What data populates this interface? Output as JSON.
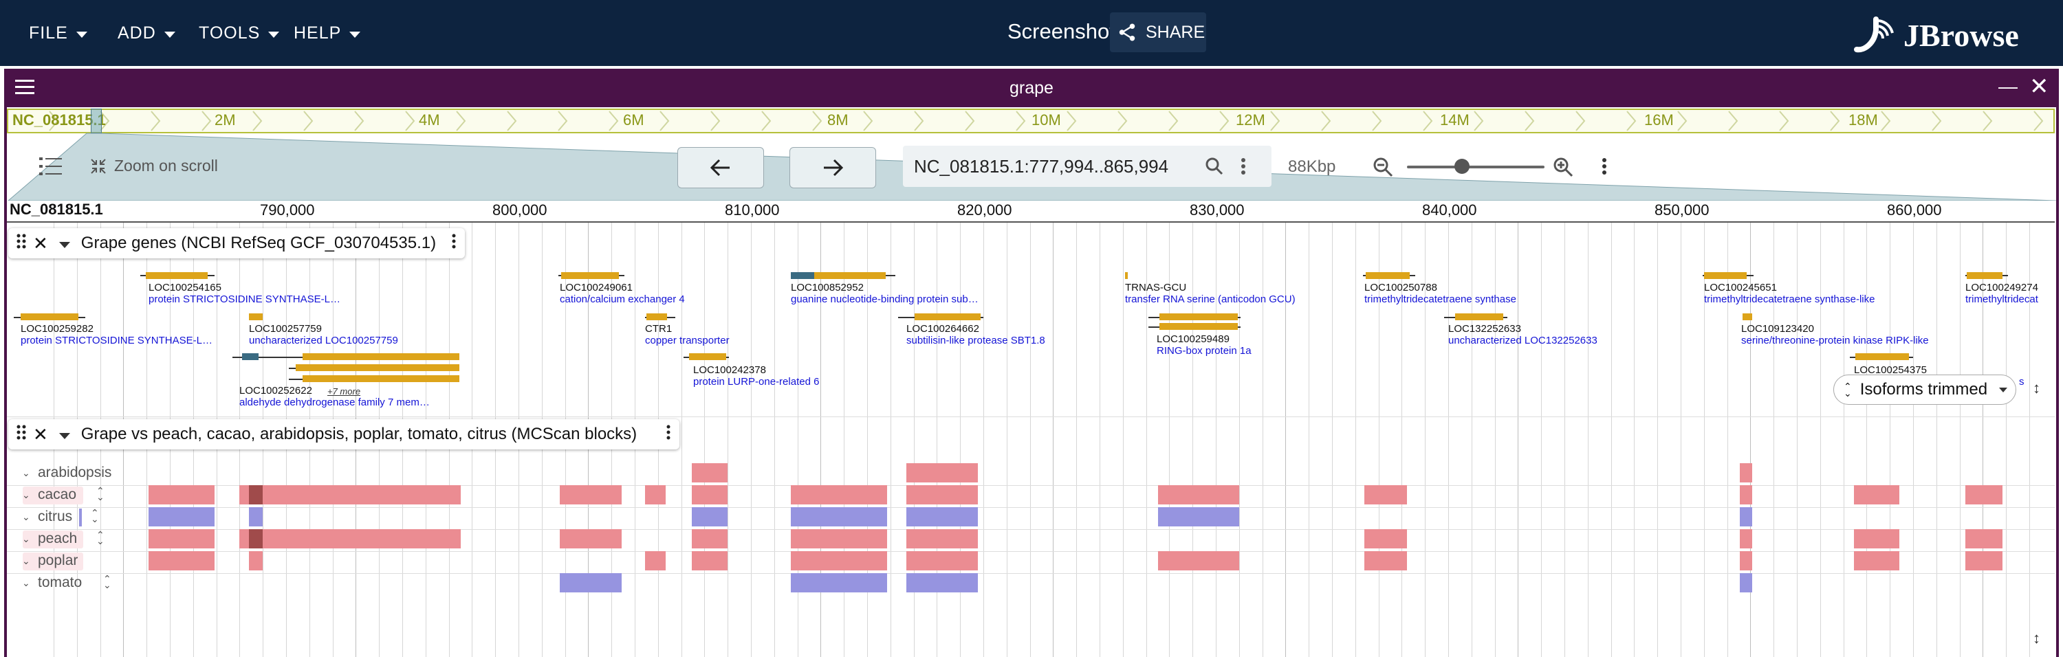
{
  "menus": [
    {
      "label": "FILE"
    },
    {
      "label": "ADD"
    },
    {
      "label": "TOOLS"
    },
    {
      "label": "HELP"
    }
  ],
  "session_title": "Screenshot",
  "share_label": "SHARE",
  "brand": "JBrowse",
  "view": {
    "title": "grape",
    "refname": "NC_081815.1",
    "overview_labels": [
      "NC_081815.1",
      "2M",
      "4M",
      "6M",
      "8M",
      "10M",
      "12M",
      "14M",
      "16M",
      "18M"
    ],
    "zoom_on_scroll_label": "Zoom on scroll",
    "locstring": "NC_081815.1:777,994..865,994",
    "bp_label": "88Kbp",
    "zoom_level_fraction": 0.4,
    "ruler_labels": [
      "NC_081815.1",
      "790,000",
      "800,000",
      "810,000",
      "820,000",
      "830,000",
      "840,000",
      "850,000",
      "860,000"
    ]
  },
  "genes_track": {
    "title": "Grape genes (NCBI RefSeq GCF_030704535.1)",
    "isoform_select": "Isoforms trimmed",
    "features": [
      {
        "name": "LOC100254165",
        "desc": "protein STRICTOSIDINE SYNTHASE-L…"
      },
      {
        "name": "LOC100259282",
        "desc": "protein STRICTOSIDINE SYNTHASE-L…"
      },
      {
        "name": "LOC100257759",
        "desc": "uncharacterized LOC100257759"
      },
      {
        "name": "LOC100252622",
        "desc": "aldehyde dehydrogenase family 7 mem…",
        "more": "+7 more"
      },
      {
        "name": "LOC100249061",
        "desc": "cation/calcium exchanger 4"
      },
      {
        "name": "CTR1",
        "desc": "copper transporter"
      },
      {
        "name": "LOC100242378",
        "desc": "protein LURP-one-related 6"
      },
      {
        "name": "LOC100852952",
        "desc": "guanine nucleotide-binding protein sub…"
      },
      {
        "name": "LOC100264662",
        "desc": "subtilisin-like protease SBT1.8"
      },
      {
        "name": "TRNAS-GCU",
        "desc": "transfer RNA serine (anticodon GCU)"
      },
      {
        "name": "LOC100259489",
        "desc": "RING-box protein 1a"
      },
      {
        "name": "LOC100250788",
        "desc": "trimethyltridecatetraene synthase"
      },
      {
        "name": "LOC132252633",
        "desc": "uncharacterized LOC132252633"
      },
      {
        "name": "LOC100245651",
        "desc": "trimethyltridecatetraene synthase-like"
      },
      {
        "name": "LOC109123420",
        "desc": "serine/threonine-protein kinase RIPK-like"
      },
      {
        "name": "LOC100254375",
        "desc": "s"
      },
      {
        "name": "LOC100249274",
        "desc": "trimethyltridecat"
      }
    ]
  },
  "synteny_track": {
    "title": "Grape vs peach, cacao, arabidopsis, poplar, tomato, citrus (MCScan blocks)",
    "rows": [
      {
        "label": "arabidopsis"
      },
      {
        "label": "cacao"
      },
      {
        "label": "citrus"
      },
      {
        "label": "peach"
      },
      {
        "label": "poplar"
      },
      {
        "label": "tomato"
      }
    ]
  },
  "colors": {
    "appbar": "#0d233f",
    "view_header": "#4a1248",
    "gene_body": "#dda41a",
    "same_strand_block": "#eb8c92",
    "opposite_strand_block": "#9694e0",
    "feature_desc": "#1414d6"
  }
}
